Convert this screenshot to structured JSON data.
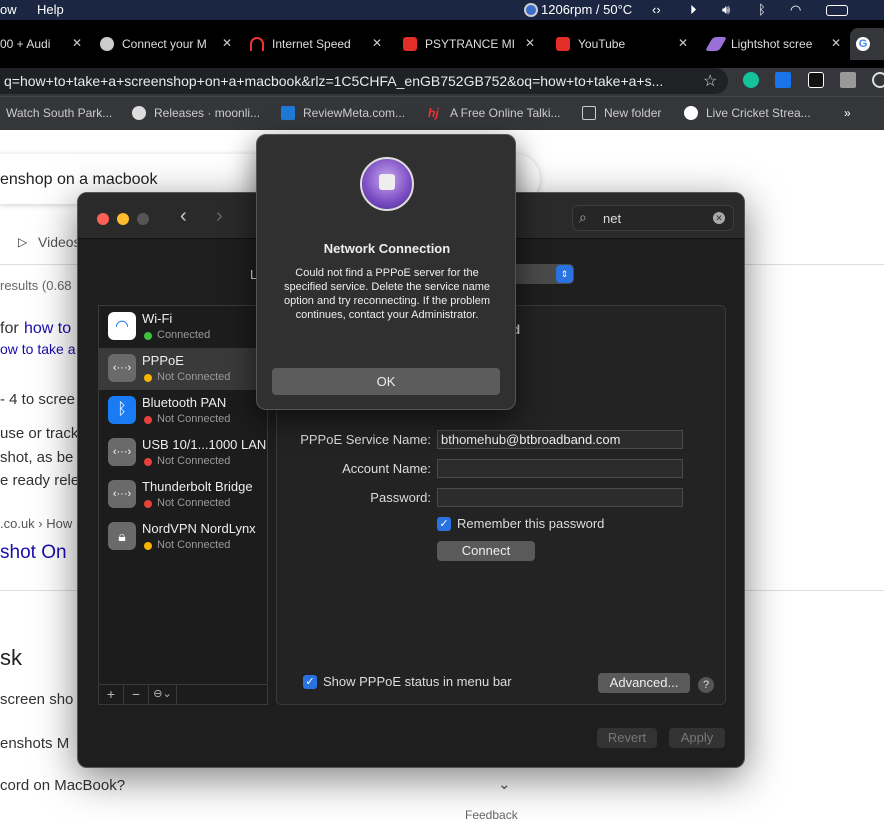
{
  "menubar": {
    "items": [
      "ow",
      "Help"
    ],
    "status_text": "1206rpm / 50°C"
  },
  "browser": {
    "tabs": [
      {
        "label": "00 + Audi",
        "icon": "generic-icon"
      },
      {
        "label": "Connect your M",
        "icon": "apple-icon"
      },
      {
        "label": "Internet Speed",
        "icon": "speedometer-icon"
      },
      {
        "label": "PSYTRANCE MI",
        "icon": "youtube-icon"
      },
      {
        "label": "YouTube",
        "icon": "youtube-icon"
      },
      {
        "label": "Lightshot scree",
        "icon": "feather-icon"
      },
      {
        "label": "",
        "icon": "google-icon",
        "active": true
      }
    ],
    "url": "q=how+to+take+a+screenshop+on+a+macbook&rlz=1C5CHFA_enGB752GB752&oq=how+to+take+a+s...",
    "bookmarks": [
      "Watch South Park...",
      "Releases · moonli...",
      "ReviewMeta.com...",
      "A Free Online Talki...",
      "New folder",
      "Live Cricket Strea..."
    ],
    "bookmarks_more": "»"
  },
  "google": {
    "query": "enshop on a macbook",
    "videos_tab": "Videos",
    "results_count": "results (0.68",
    "lines": [
      "for ",
      "how to",
      "ow to take a",
      "- 4 to scree",
      "use or track",
      "shot, as be",
      "e ready rele",
      ".co.uk › How",
      "shot On",
      "sk",
      "screen sho",
      "enshots M",
      "cord on MacBook?",
      "Feedback"
    ]
  },
  "prefs": {
    "search_value": "net",
    "location_label": "L",
    "services": [
      {
        "name": "Wi-Fi",
        "status": "Connected",
        "status_color": "#3ec23e",
        "icon": "wifi-icon"
      },
      {
        "name": "PPPoE",
        "status": "Not Connected",
        "status_color": "#f5b400",
        "icon": "ethernet-icon",
        "selected": true
      },
      {
        "name": "Bluetooth PAN",
        "status": "Not Connected",
        "status_color": "#e8403a",
        "icon": "bluetooth-icon"
      },
      {
        "name": "USB 10/1...1000 LAN",
        "status": "Not Connected",
        "status_color": "#e8403a",
        "icon": "ethernet-icon"
      },
      {
        "name": "Thunderbolt Bridge",
        "status": "Not Connected",
        "status_color": "#e8403a",
        "icon": "ethernet-icon"
      },
      {
        "name": "NordVPN NordLynx",
        "status": "Not Connected",
        "status_color": "#f5b400",
        "icon": "lock-icon"
      }
    ],
    "status_partial": "ed",
    "form": {
      "service_name_label": "PPPoE Service Name:",
      "service_name_value": "bthomehub@btbroadband.com",
      "account_label": "Account Name:",
      "account_value": "",
      "password_label": "Password:",
      "password_value": "",
      "remember_label": "Remember this password",
      "remember_checked": true,
      "connect_label": "Connect"
    },
    "show_status_label": "Show PPPoE status in menu bar",
    "show_status_checked": true,
    "advanced_label": "Advanced...",
    "help_label": "?",
    "revert_label": "Revert",
    "apply_label": "Apply"
  },
  "dialog": {
    "title": "Network Connection",
    "message": "Could not find a PPPoE server for the specified service. Delete the service name option and try reconnecting. If the problem continues, contact your Administrator.",
    "ok_label": "OK"
  }
}
